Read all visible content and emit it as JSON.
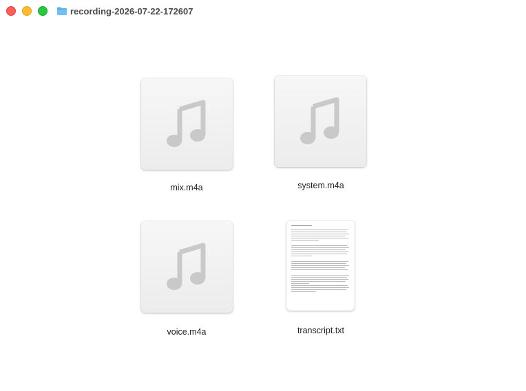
{
  "window": {
    "title": "recording-2026-07-22-172607"
  },
  "files": [
    {
      "name": "mix.m4a",
      "kind": "audio",
      "icon": "music-note-icon"
    },
    {
      "name": "system.m4a",
      "kind": "audio",
      "icon": "music-note-icon"
    },
    {
      "name": "voice.m4a",
      "kind": "audio",
      "icon": "music-note-icon"
    },
    {
      "name": "transcript.txt",
      "kind": "text",
      "icon": "text-document-preview"
    }
  ],
  "colors": {
    "close": "#ff5f57",
    "minimize": "#febc2e",
    "zoom": "#28c840",
    "folder": "#5aaee9"
  }
}
